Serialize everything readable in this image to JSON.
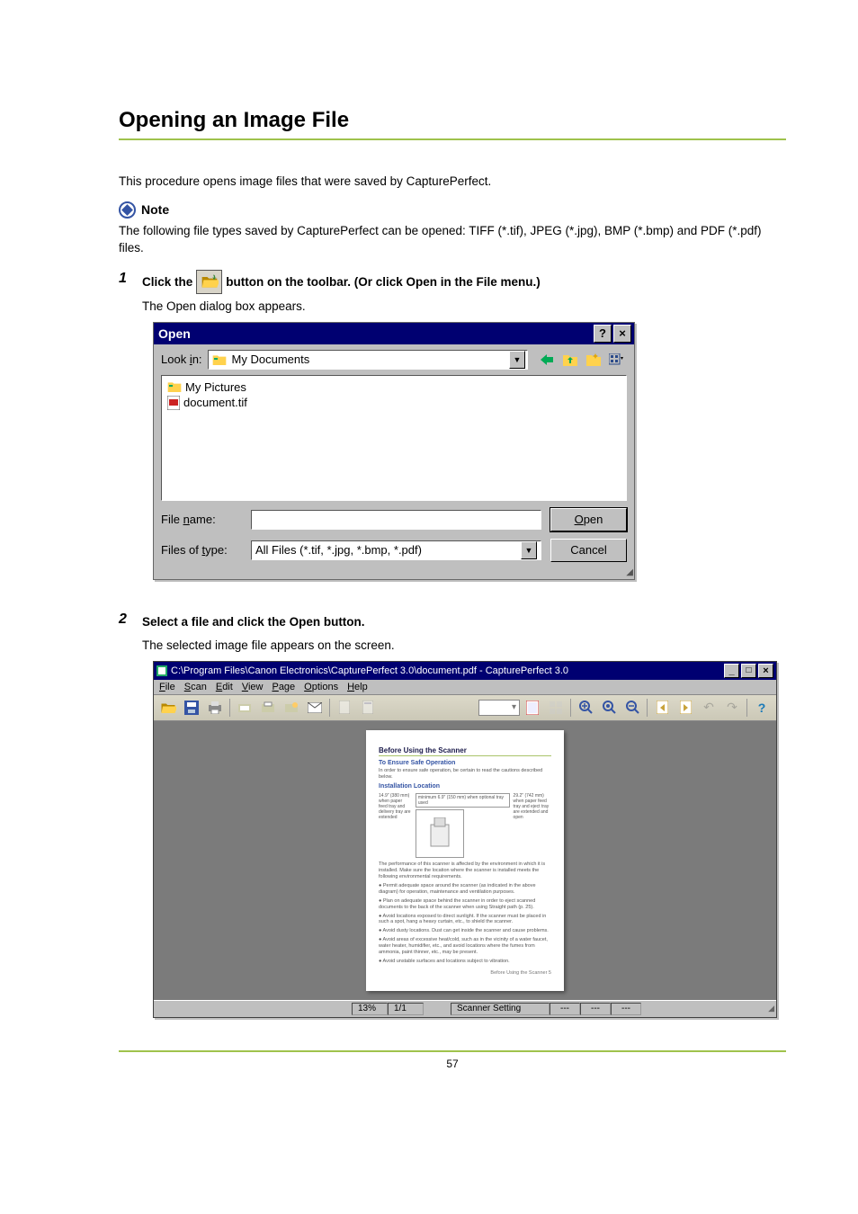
{
  "page": {
    "title": "Opening an Image File",
    "intro": "This procedure opens image files that were saved by CapturePerfect.",
    "number": "57"
  },
  "note": {
    "label": "Note",
    "text": "The following file types saved by CapturePerfect can be opened: TIFF (*.tif), JPEG (*.jpg), BMP (*.bmp) and PDF (*.pdf) files."
  },
  "step1": {
    "num": "1",
    "pre": "Click the ",
    "post": " button on the toolbar. (Or click Open in the File menu.)",
    "sub": "The Open dialog box appears."
  },
  "dialog": {
    "title": "Open",
    "help_btn": "?",
    "close_btn": "×",
    "look_in_label": "Look in:",
    "look_in_value": "My Documents",
    "items": {
      "a": "My Pictures",
      "b": "document.tif"
    },
    "file_name_label": "File name:",
    "file_name_value": "",
    "files_type_label": "Files of type:",
    "files_type_value": "All Files (*.tif, *.jpg, *.bmp, *.pdf)",
    "open_btn": "Open",
    "cancel_btn": "Cancel"
  },
  "step2": {
    "num": "2",
    "head": "Select a file and click the Open button.",
    "sub": "The selected image file appears on the screen."
  },
  "app": {
    "title": "C:\\Program Files\\Canon Electronics\\CapturePerfect 3.0\\document.pdf - CapturePerfect 3.0",
    "menu": {
      "file": "File",
      "scan": "Scan",
      "edit": "Edit",
      "view": "View",
      "page": "Page",
      "options": "Options",
      "help": "Help"
    },
    "zoom": "▾",
    "doc": {
      "h1": "Before Using the Scanner",
      "h2a": "To Ensure Safe Operation",
      "p1": "In order to ensure safe operation, be certain to read the cautions described below.",
      "h2b": "Installation Location",
      "side_l": "14.9\" (380 mm) when paper feed tray and delivery tray are extended",
      "box_t": "minimum 6.9\" (150 mm) when optional tray used",
      "side_r": "29.2\" (742 mm) when paper feed tray and eject tray are extended and open",
      "p2": "The performance of this scanner is affected by the environment in which it is installed. Make sure the location where the scanner is installed meets the following environmental requirements.",
      "b1": "Permit adequate space around the scanner (as indicated in the above diagram) for operation, maintenance and ventilation purposes.",
      "b2": "Plan on adequate space behind the scanner in order to eject scanned documents to the back of the scanner when using Straight path (p. 25).",
      "b3": "Avoid locations exposed to direct sunlight. If the scanner must be placed in such a spot, hang a heavy curtain, etc., to shield the scanner.",
      "b4": "Avoid dusty locations. Dust can get inside the scanner and cause problems.",
      "b5": "Avoid areas of excessive heat/cold, such as in the vicinity of a water faucet, water heater, humidifier, etc., and avoid locations where the fumes from ammonia, paint thinner, etc., may be present.",
      "b6": "Avoid unstable surfaces and locations subject to vibration.",
      "foot": "Before Using the Scanner     5"
    },
    "status": {
      "zoom": "13%",
      "page": "1/1",
      "setting": "Scanner Setting",
      "d1": "---",
      "d2": "---",
      "d3": "---"
    }
  }
}
